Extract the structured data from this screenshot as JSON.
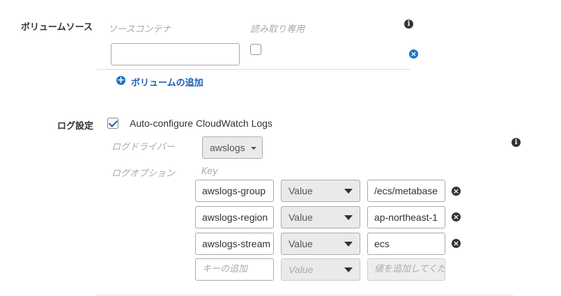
{
  "volume_source": {
    "label": "ボリュームソース",
    "col_source_container": "ソースコンテナ",
    "col_read_only": "読み取り専用",
    "source_container_value": "",
    "add_volume_label": "ボリュームの追加"
  },
  "log_config": {
    "label": "ログ設定",
    "auto_configure_label": "Auto-configure CloudWatch Logs",
    "auto_configure_checked": true,
    "log_driver_label": "ログドライバー",
    "log_driver_value": "awslogs",
    "log_options_label": "ログオプション",
    "key_header": "Key",
    "options": [
      {
        "key": "awslogs-group",
        "type": "Value",
        "value": "/ecs/metabase"
      },
      {
        "key": "awslogs-region",
        "type": "Value",
        "value": "ap-northeast-1"
      },
      {
        "key": "awslogs-stream",
        "type": "Value",
        "value": "ecs"
      }
    ],
    "new_option": {
      "key_placeholder": "キーの追加",
      "type": "Value",
      "value_placeholder": "値を追加してください"
    }
  },
  "icons": {
    "info": "info-icon",
    "remove": "remove-icon",
    "add": "plus-circle-icon",
    "dropdown": "caret-down-icon"
  },
  "colors": {
    "link": "#1a5fb4",
    "remove_blue": "#1a73c8"
  }
}
